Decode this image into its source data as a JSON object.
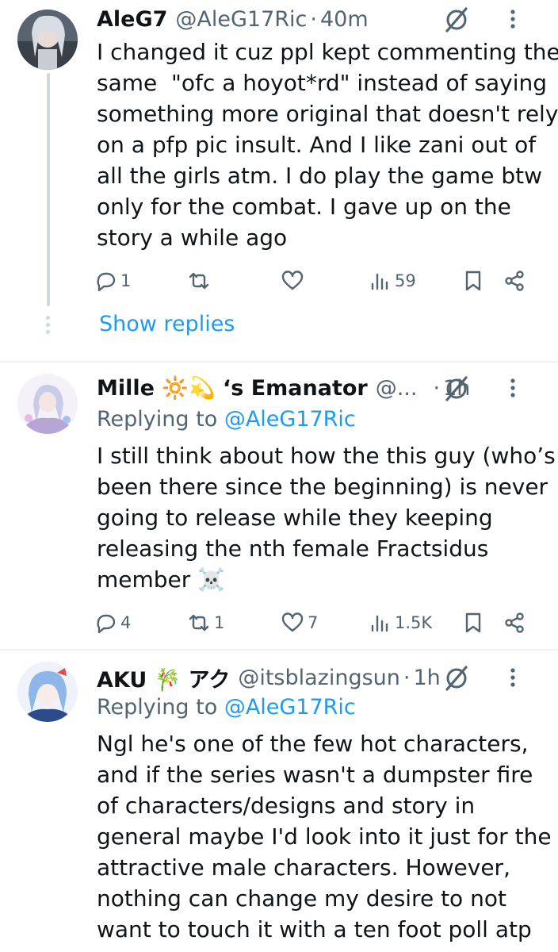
{
  "tweets": [
    {
      "name": "AleG7",
      "handle": "@AleG17Ric",
      "sep": "·",
      "time": "40m",
      "lines": [
        "I changed it cuz ppl kept commenting the",
        "same  \"ofc a hoyot*rd\" instead of saying",
        "something more original that doesn't rely",
        "on a pfp pic insult. And I like zani out of",
        "all the girls atm. I do play the game btw",
        "only for the combat. I gave up on the",
        "story a while ago"
      ],
      "replies": "1",
      "reposts": "",
      "likes": "",
      "views": "59",
      "show_replies": "Show replies"
    },
    {
      "name": "Mille 🔆💫 ‘s Emanator",
      "handle": "@...",
      "sep": "·",
      "time": "1h",
      "replying_prefix": "Replying to ",
      "replying_to": "@AleG17Ric",
      "lines": [
        "I still think about how the this guy (who’s",
        "been there since the beginning) is never",
        "going to release while they keeping",
        "releasing the nth female Fractsidus",
        "member ☠️"
      ],
      "replies": "4",
      "reposts": "1",
      "likes": "7",
      "views": "1.5K"
    },
    {
      "name": "AKU 🎋 アク",
      "handle": "@itsblazingsun",
      "sep": "·",
      "time": "1h",
      "replying_prefix": "Replying to ",
      "replying_to": "@AleG17Ric",
      "lines": [
        "Ngl he's one of the few hot characters,",
        "and if the series wasn't a dumpster fire",
        "of characters/designs and story in",
        "general maybe I'd look into it just for the",
        "attractive male characters. However,",
        "nothing can change my desire to not",
        "want to touch it with a ten foot poll atp"
      ]
    }
  ],
  "colors": {
    "text": "#0f1419",
    "secondary": "#536471",
    "accent": "#1d9bf0",
    "divider": "#eff3f4"
  },
  "icons": [
    "reply-icon",
    "repost-icon",
    "like-icon",
    "views-icon",
    "bookmark-icon",
    "share-icon",
    "grok-icon",
    "more-icon"
  ]
}
